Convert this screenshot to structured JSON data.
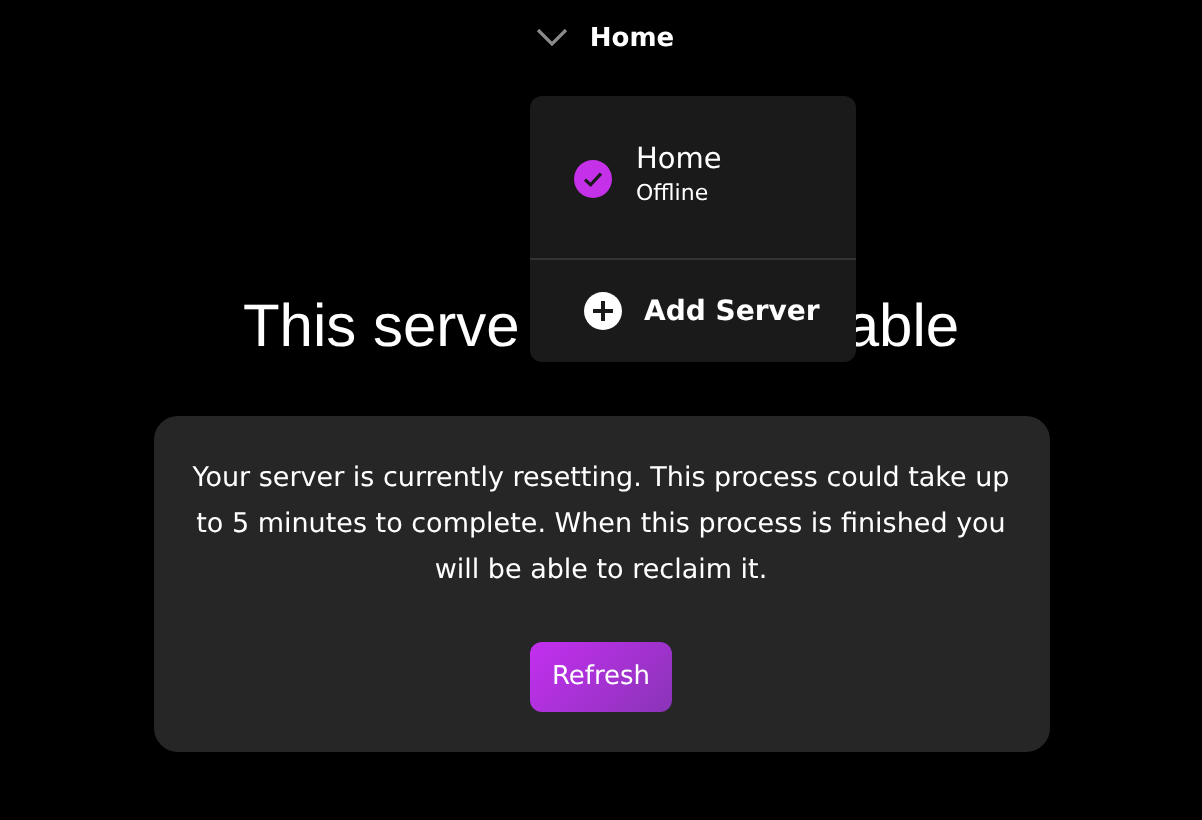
{
  "top_bar": {
    "current_server": "Home"
  },
  "server_menu": {
    "servers": [
      {
        "name": "Home",
        "status": "Offline",
        "selected": true
      }
    ],
    "add_label": "Add Server"
  },
  "heading_visible_parts": [
    "This serve",
    "able"
  ],
  "notice": {
    "message": "Your server is currently resetting. This process could take up to 5 minutes to complete. When this process is finished you will be able to reclaim it.",
    "button": "Refresh"
  }
}
